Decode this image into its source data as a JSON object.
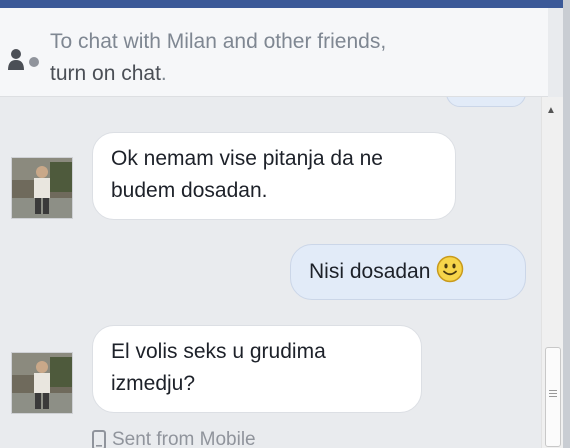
{
  "chat_notice": {
    "line1": "To chat with Milan and other friends,",
    "link": "turn on chat",
    "line_end": "."
  },
  "messages": [
    {
      "direction": "incoming",
      "text": "Ok nemam vise pitanja da ne budem dosadan."
    },
    {
      "direction": "outgoing",
      "text": "Nisi dosadan",
      "emoji": "smiley-icon"
    },
    {
      "direction": "incoming",
      "text": "El volis seks u grudima izmedju?"
    }
  ],
  "status": {
    "sent_from": "Sent from Mobile",
    "icon": "mobile-phone-icon"
  },
  "colors": {
    "header_bar": "#3b5998",
    "incoming_bubble": "#ffffff",
    "outgoing_bubble": "#e2ebf8",
    "background": "#e9ebee"
  }
}
